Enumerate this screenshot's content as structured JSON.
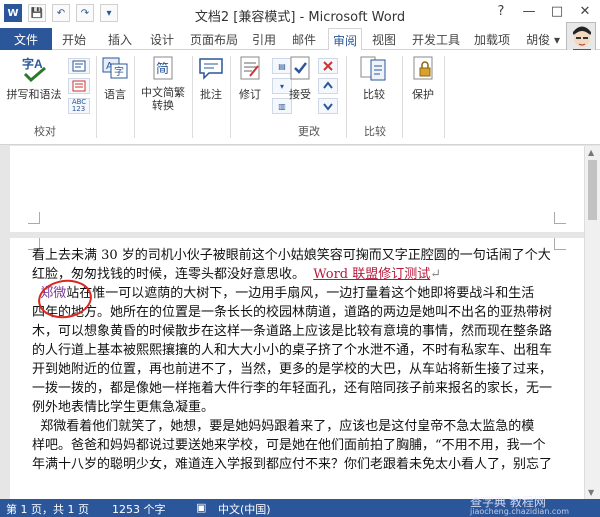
{
  "window": {
    "title": "文档2 [兼容模式] - Microsoft Word",
    "controls": [
      "?",
      "—",
      "□",
      "✕"
    ]
  },
  "quick_access": [
    "W",
    "💾",
    "↶",
    "↷",
    "▾"
  ],
  "tabs": [
    {
      "label": "文件",
      "active": false
    },
    {
      "label": "开始",
      "active": false
    },
    {
      "label": "插入",
      "active": false
    },
    {
      "label": "设计",
      "active": false
    },
    {
      "label": "页面布局",
      "active": false
    },
    {
      "label": "引用",
      "active": false
    },
    {
      "label": "邮件",
      "active": false
    },
    {
      "label": "审阅",
      "active": true
    },
    {
      "label": "视图",
      "active": false
    },
    {
      "label": "开发工具",
      "active": false
    },
    {
      "label": "加载项",
      "active": false
    }
  ],
  "user": {
    "name": "胡俊 ▾"
  },
  "ribbon": {
    "spell_label": "拼写和语法",
    "language_label": "语言",
    "chinese_label_1": "中文简繁",
    "chinese_label_2": "转换",
    "comment_label": "批注",
    "revise_label": "修订",
    "accept_label": "接受",
    "compare_label": "比较",
    "protect_label": "保护",
    "abc_label": "ABC\n123",
    "groups": {
      "proofing": "校对",
      "changes": "更改",
      "compare": "比较"
    }
  },
  "document": {
    "lines": [
      "看上去未满 30 岁的司机小伙子被眼前这个小姑娘笑容可掬而又字正腔圆的一句话闹了个大",
      "红脸，匆匆找钱的时候，连零头都没好意思收。",
      "站在惟一可以遮荫的大树下，一边用手扇风，一边打量着这个她即将要战斗和生活",
      "四年的地方。她所在的位置是一条长长的校园林荫道，道路的两边是她叫不出名的亚热带树",
      "木，可以想象黄昏的时候散步在这样一条道路上应该是比较有意境的事情，然而现在整条路",
      "的人行道上基本被熙熙攘攘的人和大大小小的桌子挤了个水泄不通，不时有私家车、出租车",
      "开到她附近的位置，再也前进不了，当然，更多的是学校的大巴，从车站将新生接了过来，",
      "一拨一拨的，都是像她一样拖着大件行李的年轻面孔，还有陪同孩子前来报名的家长，无一",
      "例外地表情比学生更焦急凝重。",
      "郑微看着他们就笑了，她想，要是她妈妈跟着来了，应该也是这付皇帝不急太监急的模",
      "样吧。爸爸和妈妈都说过要送她来学校，可是她在他们面前拍了胸脯，“不用不用，我一个",
      "年满十八岁的聪明少女，难道连入学报到都应付不来？你们老跟着未免太小看人了，别忘了"
    ],
    "inserted_text": "Word 联盟修订测试",
    "circled_name": "郑微",
    "para_mark": "↵"
  },
  "status": {
    "page": "第 1 页，共 1 页",
    "words": "1253 个字",
    "language": "中文(中国)",
    "watermark": "查字典 教程网",
    "watermark_url": "jiaocheng.chazidian.com"
  }
}
